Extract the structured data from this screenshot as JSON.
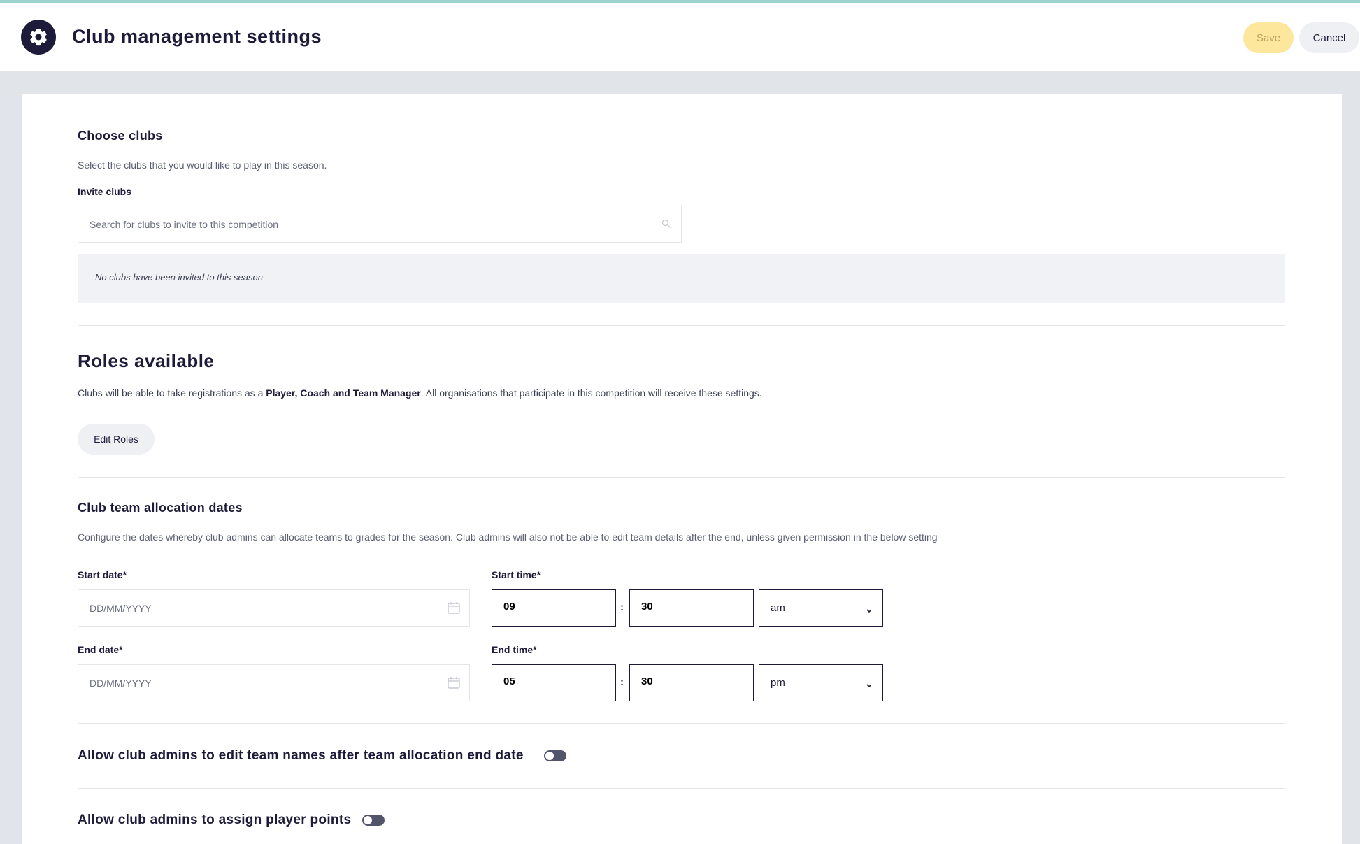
{
  "header": {
    "title": "Club management settings",
    "save_label": "Save",
    "cancel_label": "Cancel"
  },
  "choose_clubs": {
    "heading": "Choose clubs",
    "description": "Select the clubs that you would like to play in this season.",
    "invite_label": "Invite clubs",
    "search_placeholder": "Search for clubs to invite to this competition",
    "empty_message": "No clubs have been invited to this season"
  },
  "roles": {
    "heading": "Roles available",
    "description_prefix": "Clubs will be able to take registrations as a ",
    "roles_bold": "Player, Coach and Team Manager",
    "description_suffix": ". All organisations that participate in this competition will receive these settings.",
    "edit_button": "Edit Roles"
  },
  "allocation": {
    "heading": "Club team allocation dates",
    "description": "Configure the dates whereby club admins can allocate teams to grades for the season. Club admins will also not be able to edit team details after the end, unless given permission in the below setting",
    "start_date_label": "Start date*",
    "start_date_placeholder": "DD/MM/YYYY",
    "end_date_label": "End date*",
    "end_date_placeholder": "DD/MM/YYYY",
    "start_time_label": "Start time*",
    "start_hour": "09",
    "start_minute": "30",
    "start_period": "am",
    "end_time_label": "End time*",
    "end_hour": "05",
    "end_minute": "30",
    "end_period": "pm",
    "separator": ":"
  },
  "toggles": {
    "edit_team_names": {
      "label": "Allow club admins to edit team names after team allocation end date",
      "on": false
    },
    "assign_player_points": {
      "label": "Allow club admins to assign player points",
      "on": false
    }
  },
  "icons": {
    "settings": "gear-icon",
    "search": "search-icon",
    "calendar": "calendar-icon",
    "dropdown": "chevron-down-icon"
  },
  "colors": {
    "primary_dark": "#1e1b3a",
    "save_bg": "#fde79c",
    "page_bg": "#e1e4e8",
    "accent_line": "#9fd3cf"
  }
}
